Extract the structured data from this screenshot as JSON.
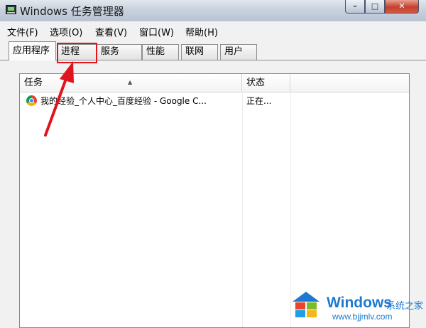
{
  "window": {
    "title": "Windows 任务管理器"
  },
  "menu": [
    "文件(F)",
    "选项(O)",
    "查看(V)",
    "窗口(W)",
    "帮助(H)"
  ],
  "tabs": [
    "应用程序",
    "进程",
    "服务",
    "性能",
    "联网",
    "用户"
  ],
  "active_tab": "应用程序",
  "list": {
    "columns": {
      "task": "任务",
      "status": "状态"
    },
    "rows": [
      {
        "task": "我的经验_个人中心_百度经验 - Google C...",
        "status": "正在..."
      }
    ]
  },
  "annotation": {
    "highlight_color": "#e0141a"
  },
  "watermark": {
    "brand": "Windows",
    "suffix": "系统之家",
    "url": "www.bjjmlv.com"
  }
}
